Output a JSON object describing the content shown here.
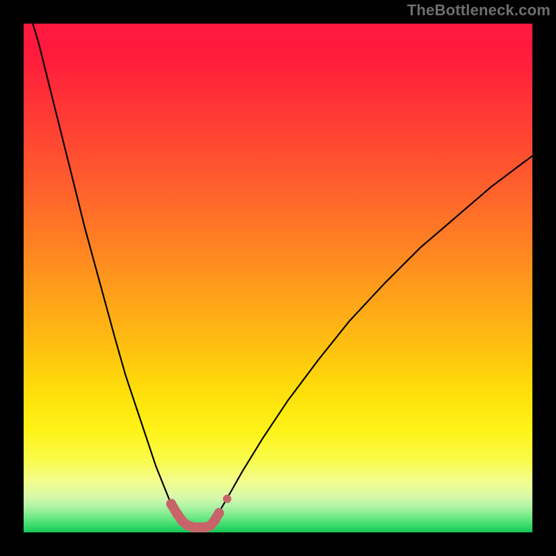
{
  "watermark": "TheBottleneck.com",
  "chart_data": {
    "type": "line",
    "title": "",
    "xlabel": "",
    "ylabel": "",
    "xlim": [
      0,
      100
    ],
    "ylim": [
      0,
      100
    ],
    "grid": false,
    "series": [
      {
        "name": "bottleneck-curve",
        "x": [
          0,
          3,
          6,
          9,
          12,
          15,
          18,
          20,
          22,
          24,
          26,
          28,
          29,
          30.5,
          32,
          33,
          34,
          35,
          36,
          37,
          38,
          40,
          43,
          47,
          52,
          58,
          64,
          71,
          78,
          85,
          92,
          100
        ],
        "y": [
          106,
          96,
          84,
          72,
          60,
          49,
          38,
          31,
          25,
          19,
          13,
          8,
          5.5,
          3.2,
          1.8,
          1.2,
          1.0,
          1.0,
          1.2,
          1.8,
          3.3,
          6.7,
          12,
          18.5,
          26,
          34,
          41.5,
          49,
          56,
          62,
          68,
          74
        ]
      }
    ],
    "highlight": {
      "name": "valley-marker",
      "color": "#c86469",
      "points": [
        {
          "x": 29.0,
          "y": 5.6
        },
        {
          "x": 30.2,
          "y": 3.6
        },
        {
          "x": 31.2,
          "y": 2.2
        },
        {
          "x": 32.2,
          "y": 1.4
        },
        {
          "x": 33.4,
          "y": 1.0
        },
        {
          "x": 34.6,
          "y": 1.0
        },
        {
          "x": 35.8,
          "y": 1.0
        },
        {
          "x": 36.8,
          "y": 1.4
        },
        {
          "x": 37.6,
          "y": 2.4
        },
        {
          "x": 38.4,
          "y": 3.8
        },
        {
          "x": 40.0,
          "y": 6.6
        }
      ]
    }
  }
}
